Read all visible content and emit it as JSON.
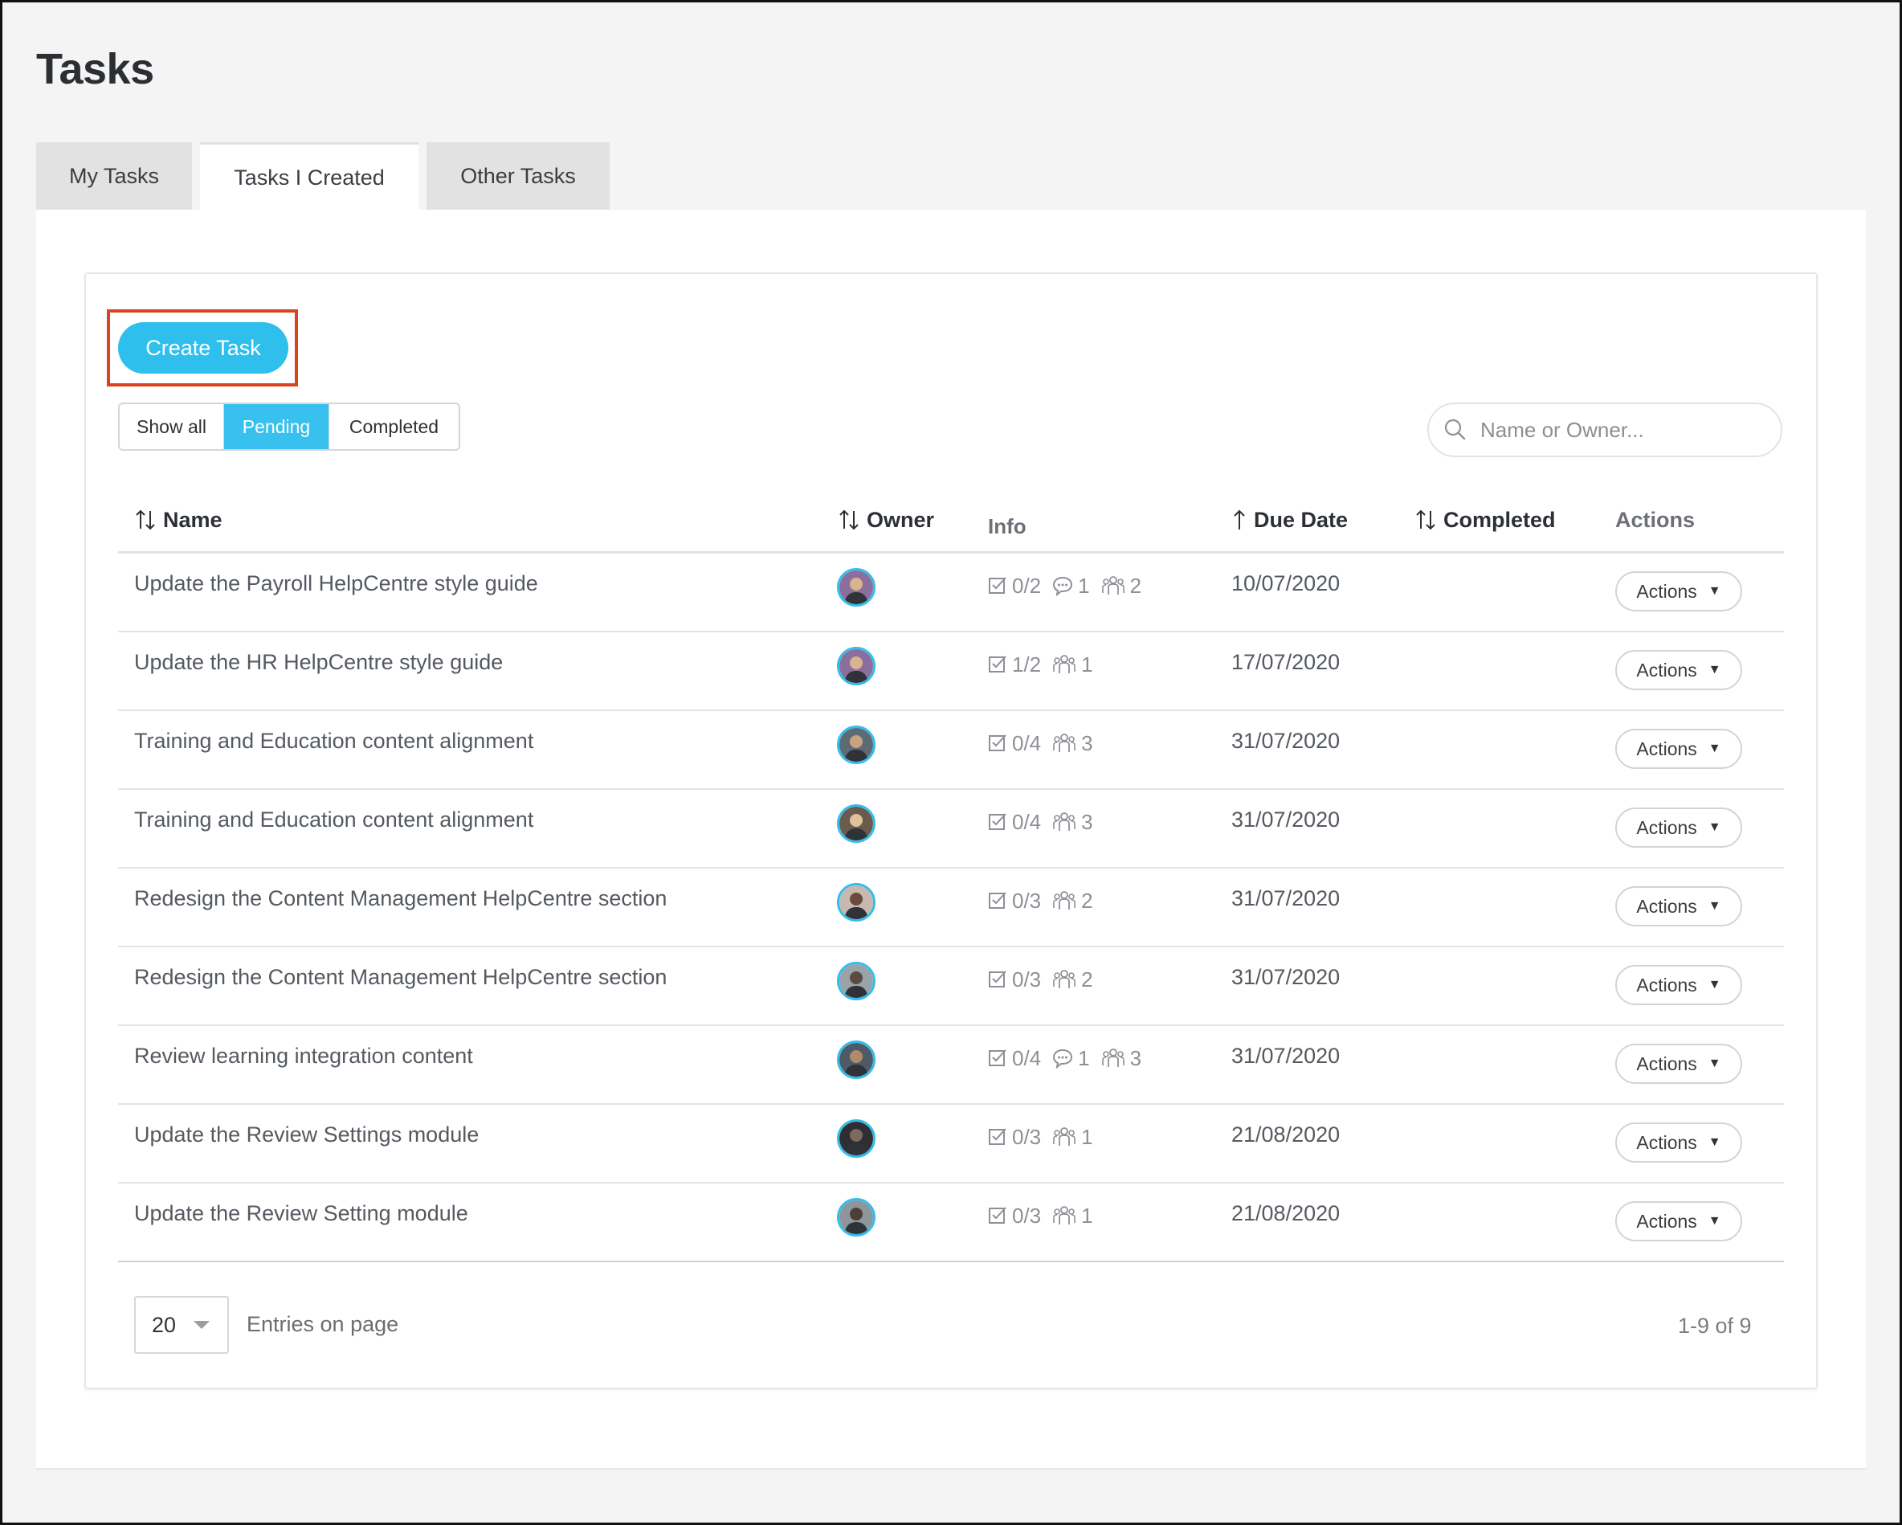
{
  "page": {
    "title": "Tasks"
  },
  "tabs": [
    {
      "label": "My Tasks",
      "active": false
    },
    {
      "label": "Tasks I Created",
      "active": true
    },
    {
      "label": "Other Tasks",
      "active": false
    }
  ],
  "toolbar": {
    "create_label": "Create Task",
    "filters": [
      {
        "label": "Show all",
        "active": false
      },
      {
        "label": "Pending",
        "active": true
      },
      {
        "label": "Completed",
        "active": false
      }
    ],
    "search_placeholder": "Name or Owner..."
  },
  "table": {
    "columns": [
      {
        "label": "Name",
        "icon": "sort-both-icon"
      },
      {
        "label": "Owner",
        "icon": "sort-both-icon"
      },
      {
        "label": "Info",
        "icon": ""
      },
      {
        "label": "Due Date",
        "icon": "sort-up-icon"
      },
      {
        "label": "Completed",
        "icon": "sort-both-icon"
      },
      {
        "label": "Actions",
        "icon": ""
      }
    ],
    "rows": [
      {
        "name": "Update the Payroll HelpCentre style guide",
        "checklist": "0/2",
        "comments": "1",
        "people": "2",
        "due": "10/07/2020",
        "action": "Actions"
      },
      {
        "name": "Update the HR HelpCentre style guide",
        "checklist": "1/2",
        "comments": "",
        "people": "1",
        "due": "17/07/2020",
        "action": "Actions"
      },
      {
        "name": "Training and Education content alignment",
        "checklist": "0/4",
        "comments": "",
        "people": "3",
        "due": "31/07/2020",
        "action": "Actions"
      },
      {
        "name": "Training and Education content alignment",
        "checklist": "0/4",
        "comments": "",
        "people": "3",
        "due": "31/07/2020",
        "action": "Actions"
      },
      {
        "name": "Redesign the Content Management HelpCentre section",
        "checklist": "0/3",
        "comments": "",
        "people": "2",
        "due": "31/07/2020",
        "action": "Actions"
      },
      {
        "name": "Redesign the Content Management HelpCentre section",
        "checklist": "0/3",
        "comments": "",
        "people": "2",
        "due": "31/07/2020",
        "action": "Actions"
      },
      {
        "name": "Review learning integration content",
        "checklist": "0/4",
        "comments": "1",
        "people": "3",
        "due": "31/07/2020",
        "action": "Actions"
      },
      {
        "name": "Update the Review Settings module",
        "checklist": "0/3",
        "comments": "",
        "people": "1",
        "due": "21/08/2020",
        "action": "Actions"
      },
      {
        "name": "Update the Review Setting module",
        "checklist": "0/3",
        "comments": "",
        "people": "1",
        "due": "21/08/2020",
        "action": "Actions"
      }
    ]
  },
  "footer": {
    "per_page": "20",
    "per_page_label": "Entries on page",
    "range": "1-9 of 9"
  },
  "colors": {
    "accent": "#2ebfec",
    "highlight": "#d9431f",
    "avatar_ring": "#35bde9"
  }
}
